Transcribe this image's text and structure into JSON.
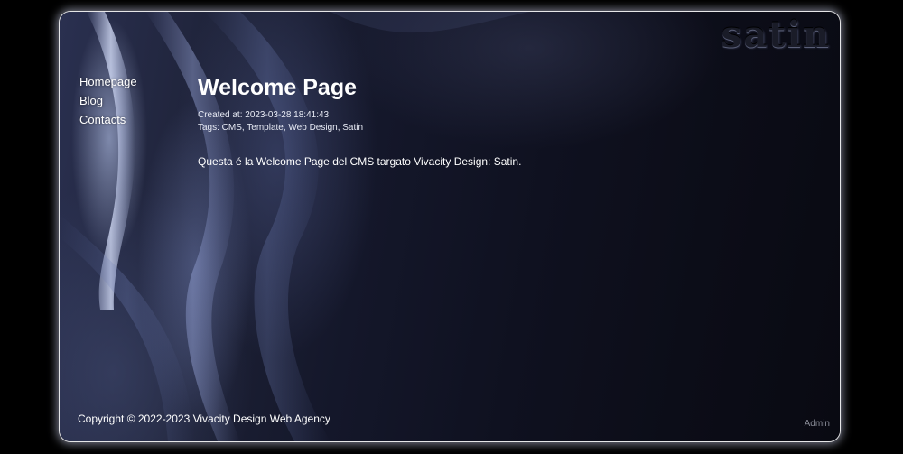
{
  "site": {
    "logo_text": "satin",
    "accent_color": "#ffffff",
    "background_color": "#0c0d18"
  },
  "nav": {
    "items": [
      {
        "label": "Homepage"
      },
      {
        "label": "Blog"
      },
      {
        "label": "Contacts"
      }
    ]
  },
  "page": {
    "title": "Welcome Page",
    "created": "Created at: 2023-03-28 18:41:43",
    "tags": "Tags: CMS, Template, Web Design, Satin",
    "body": "Questa é la Welcome Page del CMS targato Vivacity Design: Satin."
  },
  "footer": {
    "copyright": "Copyright © 2022-2023 Vivacity Design Web Agency",
    "admin_link": "Admin"
  }
}
